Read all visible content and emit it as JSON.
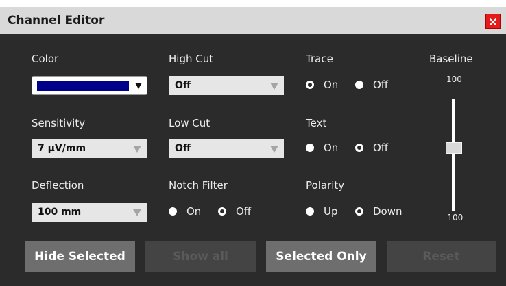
{
  "window": {
    "title": "Channel Editor"
  },
  "color": {
    "label": "Color",
    "value": "#00008b"
  },
  "high_cut": {
    "label": "High Cut",
    "value": "Off"
  },
  "low_cut": {
    "label": "Low Cut",
    "value": "Off"
  },
  "sensitivity": {
    "label": "Sensitivity",
    "value": "7 μV/mm"
  },
  "deflection": {
    "label": "Deflection",
    "value": "100 mm"
  },
  "notch_filter": {
    "label": "Notch Filter",
    "options": [
      "On",
      "Off"
    ],
    "selected": "Off"
  },
  "trace": {
    "label": "Trace",
    "options": [
      "On",
      "Off"
    ],
    "selected": "On"
  },
  "text": {
    "label": "Text",
    "options": [
      "On",
      "Off"
    ],
    "selected": "Off"
  },
  "polarity": {
    "label": "Polarity",
    "options": [
      "Up",
      "Down"
    ],
    "selected": "Down"
  },
  "baseline": {
    "label": "Baseline",
    "max": "100",
    "min": "-100",
    "value": 0
  },
  "buttons": {
    "hide_selected": "Hide Selected",
    "show_all": "Show all",
    "selected_only": "Selected Only",
    "reset": "Reset"
  },
  "colors": {
    "close": "#e31b1b",
    "panel": "#2b2b2b",
    "titlebar": "#d9d9d9"
  },
  "icons": {
    "close": "close-icon",
    "dropdown": "chevron-down-icon"
  }
}
